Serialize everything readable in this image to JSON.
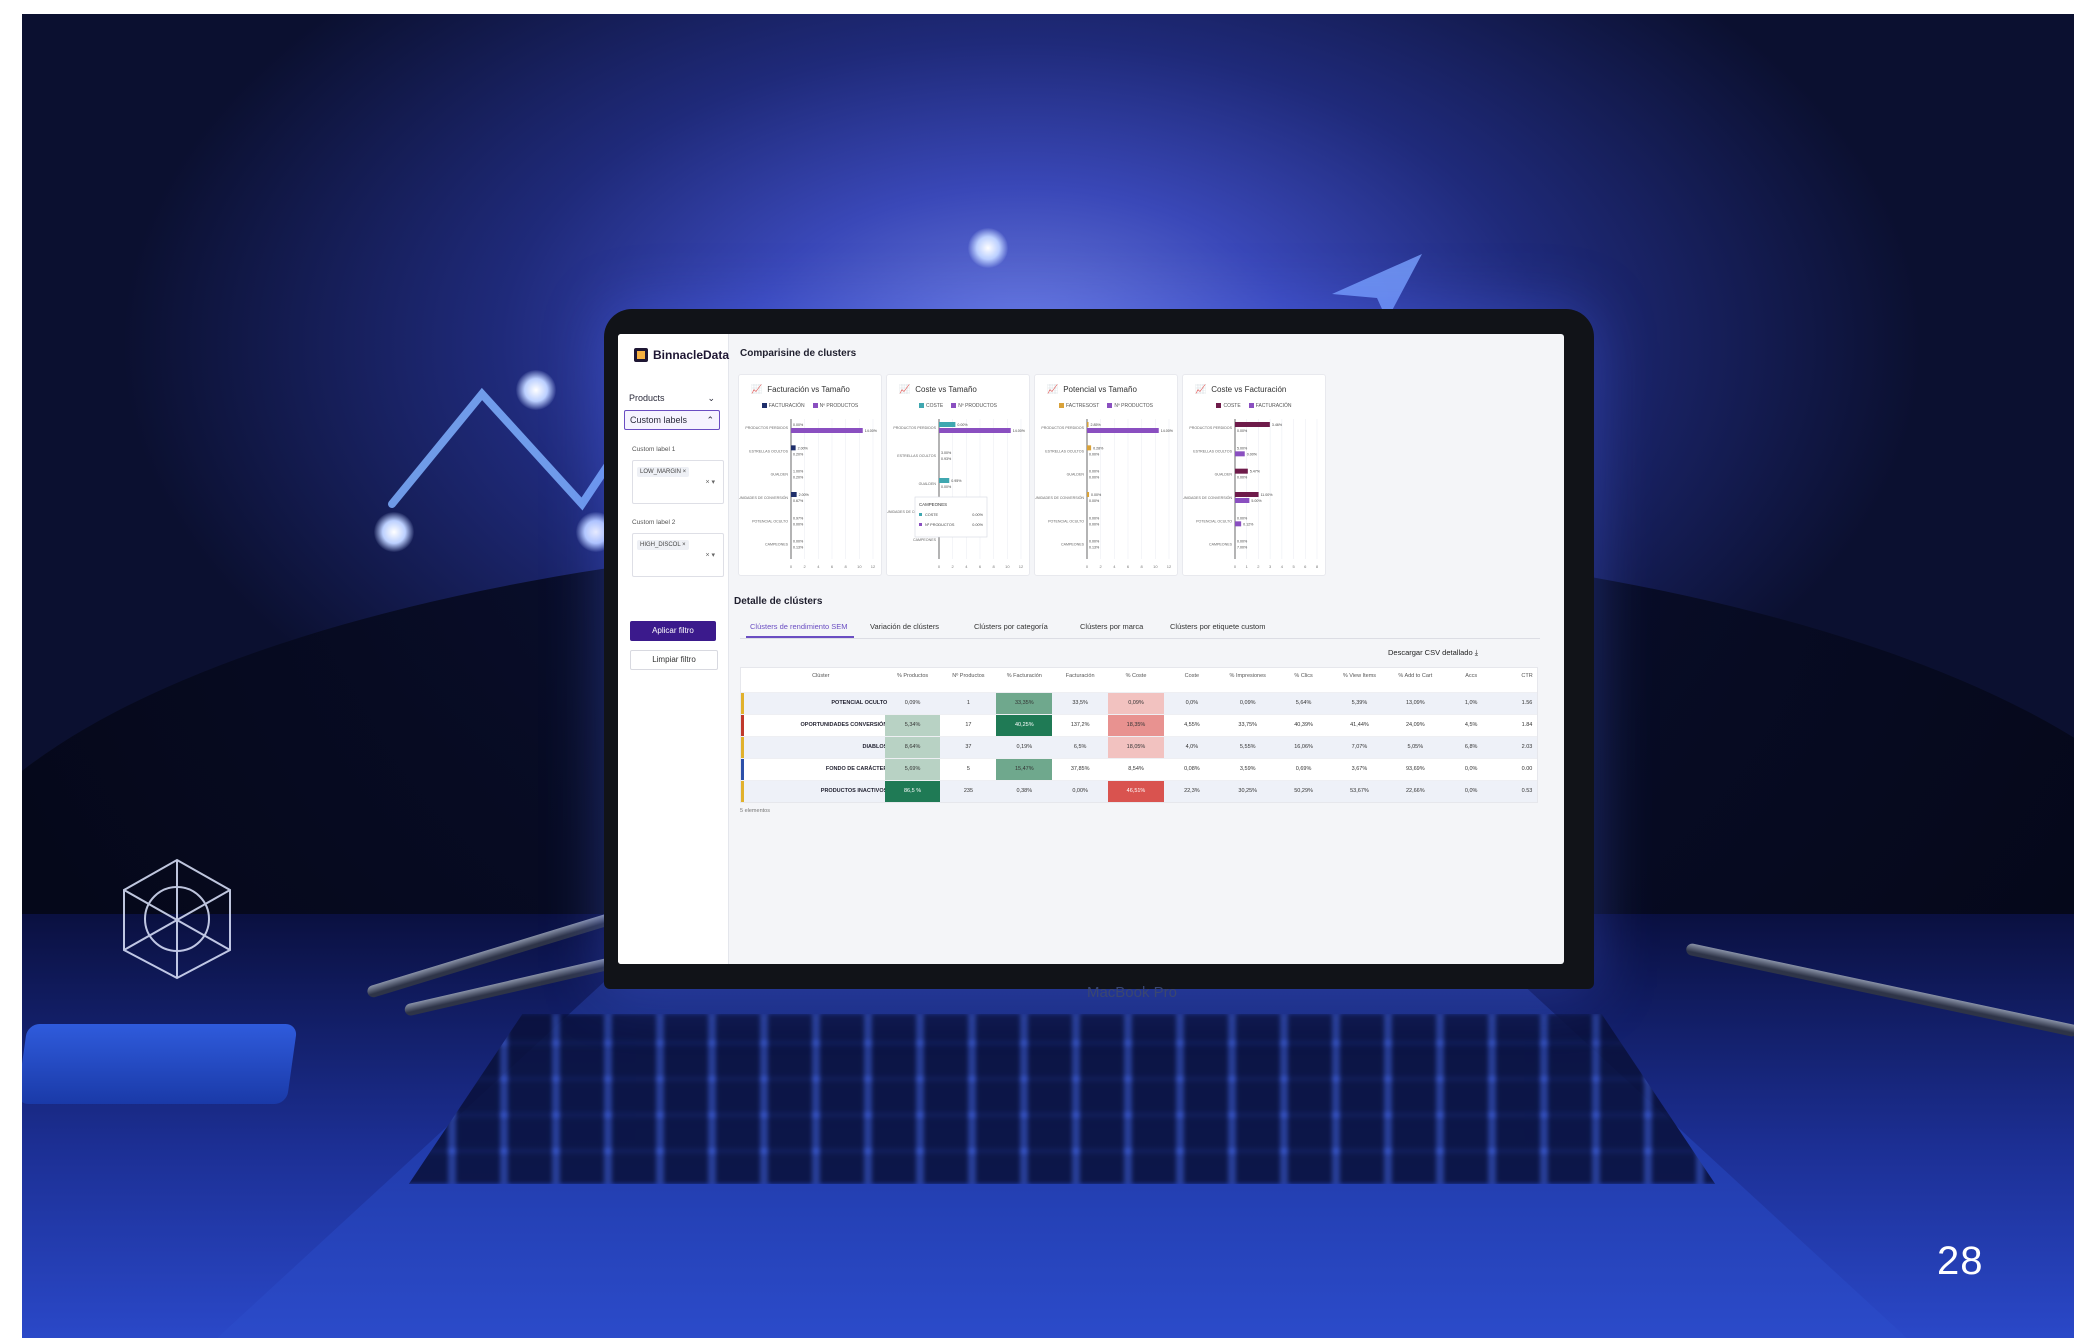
{
  "colors": {
    "accent": "#6a4dc2",
    "primary_button": "#3b1a8c",
    "bar_purple": "#8a4fc0",
    "bar_navy": "#1f2f6b",
    "bar_teal": "#3fa7b0",
    "bar_gold": "#d9a23a",
    "bar_maroon": "#6e1b4a",
    "stripe_yellow": "#e1b12c",
    "stripe_red": "#c0392b",
    "stripe_blue": "#2c4fa8",
    "heat_green": "#1f7a55",
    "heat_red": "#d9534f"
  },
  "decor": {
    "page_number": "28",
    "laptop_label": "MacBook Pro"
  },
  "sidebar": {
    "logo": "BinnacleData",
    "items": [
      {
        "label": "Products",
        "icon": "chevron-down-icon"
      },
      {
        "label": "Custom labels",
        "icon": "chevron-up-icon"
      }
    ],
    "filters": [
      {
        "label": "Custom label 1",
        "value": "LOW_MARGIN"
      },
      {
        "label": "Custom label 2",
        "value": "HIGH_DISCOL"
      }
    ],
    "apply_button": "Aplicar filtro",
    "clear_button": "Limpiar filtro"
  },
  "comparison": {
    "title": "Comparisine de clusters"
  },
  "chart_data": [
    {
      "type": "bar",
      "title": "Facturación vs Tamaño",
      "legend": [
        "FACTURACIÓN",
        "Nº PRODUCTOS"
      ],
      "categories": [
        "PRODUCTOS PERDIDOS",
        "ESTRELLAS OCULTOS",
        "GUALDEN",
        "OPORTUNIDADES DE CONVERSIÓN",
        "POTENCIAL OCULTO",
        "CAMPEONES"
      ],
      "series": [
        {
          "name": "FACTURACIÓN",
          "values": [
            0.0,
            0.9,
            0.0,
            1.1,
            0.0,
            0.0
          ]
        },
        {
          "name": "Nº PRODUCTOS",
          "values": [
            14.0,
            0.0,
            0.0,
            0.0,
            0.0,
            0.0
          ]
        }
      ],
      "bar_labels": [
        "0.00%",
        "14.00%",
        "2.00%",
        "0.20%",
        "1.00%",
        "0.20%",
        "2.00%",
        "0.67%",
        "0.97%",
        "0.00%",
        "0.00%",
        "0.13%"
      ],
      "x_ticks": [
        "0",
        "2",
        "4",
        "6",
        "8",
        "10",
        "12"
      ]
    },
    {
      "type": "bar",
      "title": "Coste vs Tamaño",
      "legend": [
        "COSTE",
        "Nº PRODUCTOS"
      ],
      "categories": [
        "PRODUCTOS PERDIDOS",
        "ESTRELLAS OCULTOS",
        "GUALDEN",
        "OPORTUNIDADES DE CONVERSIÓN",
        "CAMPEONES"
      ],
      "series": [
        {
          "name": "COSTE",
          "values": [
            3.2,
            0.0,
            2.0,
            1.9,
            0.0
          ]
        },
        {
          "name": "Nº PRODUCTOS",
          "values": [
            14.0,
            0.0,
            0.0,
            0.0,
            0.0
          ]
        }
      ],
      "bar_labels": [
        "0.00%",
        "14.00%",
        "3.00%",
        "0.93%",
        "0.95%",
        "0.00%",
        "1.02%",
        "0.00%"
      ],
      "tooltip": {
        "title": "CAMPEONES",
        "rows": [
          {
            "label": "COSTE",
            "value": "0.00%"
          },
          {
            "label": "Nº PRODUCTOS",
            "value": "0.00%"
          }
        ]
      },
      "x_ticks": [
        "0",
        "2",
        "4",
        "6",
        "8",
        "10",
        "12"
      ]
    },
    {
      "type": "bar",
      "title": "Potencial vs Tamaño",
      "legend": [
        "FACTRESOST",
        "Nº PRODUCTOS"
      ],
      "categories": [
        "PRODUCTOS PERDIDOS",
        "ESTRELLAS OCULTOS",
        "GUALDEN",
        "OPORTUNIDADES DE CONVERSIÓN",
        "POTENCIAL OCULTO",
        "CAMPEONES"
      ],
      "series": [
        {
          "name": "FACTRESOST",
          "values": [
            0.3,
            0.8,
            0.0,
            0.4,
            0.0,
            0.0
          ]
        },
        {
          "name": "Nº PRODUCTOS",
          "values": [
            14.0,
            0.0,
            0.0,
            0.0,
            0.0,
            0.0
          ]
        }
      ],
      "bar_labels": [
        "2.85%",
        "14.00%",
        "0.28%",
        "0.00%",
        "0.00%",
        "0.00%",
        "0.00%",
        "0.00%",
        "0.00%",
        "0.00%",
        "0.00%",
        "0.13%"
      ],
      "x_ticks": [
        "0",
        "2",
        "4",
        "6",
        "8",
        "10",
        "12"
      ]
    },
    {
      "type": "bar",
      "title": "Coste vs Facturación",
      "legend": [
        "COSTE",
        "FACTURACIÓN"
      ],
      "categories": [
        "PRODUCTOS PERDIDOS",
        "ESTRELLAS OCULTOS",
        "GUALDEN",
        "OPORTUNIDADES DE CONVERSIÓN",
        "POTENCIAL OCULTO",
        "CAMPEONES"
      ],
      "series": [
        {
          "name": "COSTE",
          "values": [
            6.8,
            0.0,
            2.5,
            4.6,
            0.0,
            0.0
          ]
        },
        {
          "name": "FACTURACIÓN",
          "values": [
            0.0,
            1.9,
            0.0,
            2.8,
            1.2,
            0.0
          ]
        }
      ],
      "bar_labels": [
        "3.46%",
        "0.00%",
        "5.00%",
        "0.00%",
        "5.47%",
        "0.00%",
        "11.00%",
        "5.00%",
        "0.00%",
        "0.12%",
        "0.00%",
        "7.00%"
      ],
      "x_ticks": [
        "0",
        "1",
        "2",
        "3",
        "4",
        "5",
        "6",
        "8"
      ]
    }
  ],
  "detail": {
    "title": "Detalle de clústers",
    "tabs": [
      "Clústers de rendimiento SEM",
      "Variación de clústers",
      "Clústers por categoría",
      "Clústers por marca",
      "Clústers por etiquete custom"
    ],
    "csv_link": "Descargar CSV detallado ⤓",
    "columns": [
      "Clúster",
      "% Productos",
      "Nº Productos",
      "% Facturación",
      "Facturación",
      "% Coste",
      "Coste",
      "% Impresiones",
      "% Clics",
      "% View Items",
      "% Add to Cart",
      "Accs",
      "CTR"
    ],
    "rows": [
      {
        "name": "POTENCIAL OCULTO",
        "cells": [
          "0,09%",
          "1",
          "33,35%",
          "33,5%",
          "0,09%",
          "0,0%",
          "0,09%",
          "5,64%",
          "5,39%",
          "13,09%",
          "1,0%",
          "1.56"
        ]
      },
      {
        "name": "OPORTUNIDADES CONVERSIÓN",
        "cells": [
          "5,34%",
          "17",
          "40,25%",
          "137,2%",
          "18,35%",
          "4,55%",
          "33,75%",
          "40,39%",
          "41,44%",
          "24,09%",
          "4,5%",
          "1.84"
        ]
      },
      {
        "name": "DIABLOS",
        "cells": [
          "8,64%",
          "37",
          "0,19%",
          "6,5%",
          "18,05%",
          "4,0%",
          "5,55%",
          "16,06%",
          "7,07%",
          "5,05%",
          "6,8%",
          "2.03"
        ]
      },
      {
        "name": "FONDO DE CARÁCTER",
        "cells": [
          "5,69%",
          "5",
          "15,47%",
          "37,85%",
          "8,54%",
          "0,08%",
          "3,59%",
          "0,69%",
          "3,67%",
          "93,69%",
          "0,0%",
          "0.00"
        ]
      },
      {
        "name": "PRODUCTOS INACTIVOS",
        "cells": [
          "86,5 %",
          "235",
          "0,38%",
          "0,00%",
          "46,51%",
          "22,3%",
          "30,25%",
          "50,29%",
          "53,67%",
          "22,66%",
          "0,0%",
          "0.53"
        ]
      }
    ],
    "footnote": "5 elementos"
  }
}
